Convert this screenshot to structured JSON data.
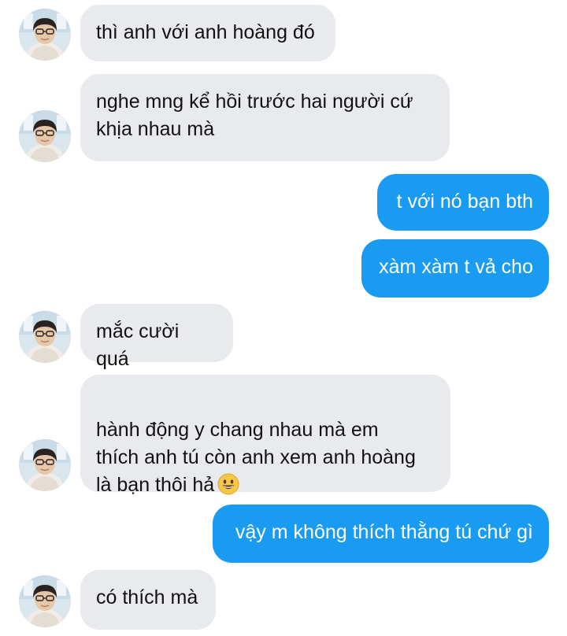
{
  "colors": {
    "incoming_bubble": "#e8eaed",
    "outgoing_bubble": "#1a9bf2",
    "incoming_text": "#111111",
    "outgoing_text": "#ffffff"
  },
  "messages": [
    {
      "sender": "other",
      "text": "thì anh với anh hoàng đó"
    },
    {
      "sender": "other",
      "text": "nghe mng kể hồi trước hai người cứ\nkhịa nhau mà"
    },
    {
      "sender": "me",
      "text": "t với nó bạn bth"
    },
    {
      "sender": "me",
      "text": "xàm xàm t vả cho"
    },
    {
      "sender": "other",
      "text": "mắc cười quá"
    },
    {
      "sender": "other",
      "text": "hành động y chang nhau mà em\nthích anh tú còn anh xem anh hoàng\nlà bạn thôi hả",
      "emoji": "grinning-face-emoji"
    },
    {
      "sender": "me",
      "text": "vậy m không thích thằng tú chứ gì"
    },
    {
      "sender": "other",
      "text": "có thích mà"
    }
  ],
  "avatar_icon": "user-avatar-photo"
}
